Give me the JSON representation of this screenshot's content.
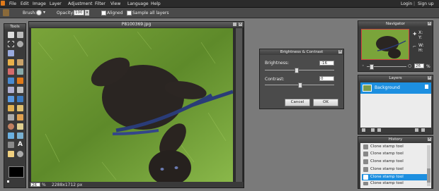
{
  "menu": {
    "items": [
      "File",
      "Edit",
      "Image",
      "Layer",
      "Adjustment",
      "Filter",
      "View",
      "Language",
      "Help"
    ],
    "login": "Login",
    "separator": "|",
    "signup": "Sign up"
  },
  "options": {
    "brush_label": "Brush:",
    "opacity_label": "Opacity:",
    "opacity_value": "100",
    "aligned_label": "Aligned",
    "sample_label": "Sample all layers"
  },
  "tools": {
    "title": "Tools"
  },
  "image_window": {
    "title": "P8100369.jpg",
    "zoom": "26",
    "zoom_unit": "%",
    "dimensions": "2288x1712 px"
  },
  "dialog": {
    "title": "Brightness & Contrast",
    "brightness_label": "Brightness:",
    "brightness_value": "-16",
    "contrast_label": "Contrast:",
    "contrast_value": "0",
    "cancel_label": "Cancel",
    "ok_label": "OK"
  },
  "navigator": {
    "title": "Navigator",
    "x_label": "X:",
    "y_label": "Y:",
    "w_label": "W:",
    "h_label": "H:",
    "zoom_value": "26",
    "zoom_unit": "%"
  },
  "layers": {
    "title": "Layers",
    "items": [
      {
        "name": "Background"
      }
    ]
  },
  "history": {
    "title": "History",
    "items": [
      "Clone stamp tool",
      "Clone stamp tool",
      "Clone stamp tool",
      "Clone stamp tool",
      "Clone stamp tool",
      "Clone stamp tool"
    ],
    "selected_index": 5
  },
  "colors": {
    "selection": "#1d8fe0",
    "menubar": "#2b2b2b",
    "accent_orange": "#e07a1a"
  }
}
